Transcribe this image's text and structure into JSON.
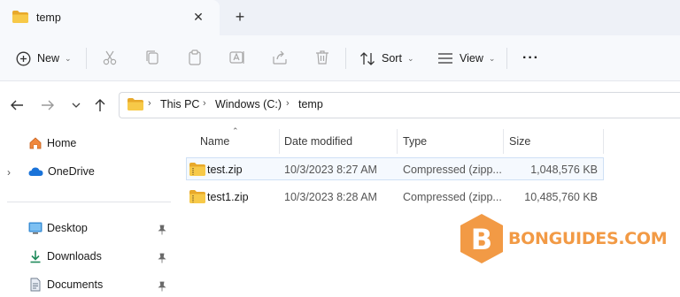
{
  "tab": {
    "title": "temp"
  },
  "toolbar": {
    "new_label": "New",
    "sort_label": "Sort",
    "view_label": "View",
    "more_label": "···"
  },
  "breadcrumb": [
    "This PC",
    "Windows (C:)",
    "temp"
  ],
  "sidebar": {
    "items": [
      {
        "label": "Home",
        "icon": "home-icon"
      },
      {
        "label": "OneDrive",
        "icon": "cloud-icon"
      },
      {
        "label": "Desktop",
        "icon": "desktop-icon",
        "pinned": true
      },
      {
        "label": "Downloads",
        "icon": "download-icon",
        "pinned": true
      },
      {
        "label": "Documents",
        "icon": "document-icon",
        "pinned": true
      }
    ]
  },
  "columns": [
    "Name",
    "Date modified",
    "Type",
    "Size"
  ],
  "files": [
    {
      "name": "test.zip",
      "date": "10/3/2023 8:27 AM",
      "type": "Compressed (zipp...",
      "size": "1,048,576 KB"
    },
    {
      "name": "test1.zip",
      "date": "10/3/2023 8:28 AM",
      "type": "Compressed (zipp...",
      "size": "10,485,760 KB"
    }
  ],
  "watermark": {
    "text": "BONGUIDES.COM",
    "letter": "B"
  },
  "colors": {
    "folder": "#f4c04a",
    "accent": "#0067c0",
    "watermark": "#f29a45",
    "cloud": "#1a73d9"
  }
}
